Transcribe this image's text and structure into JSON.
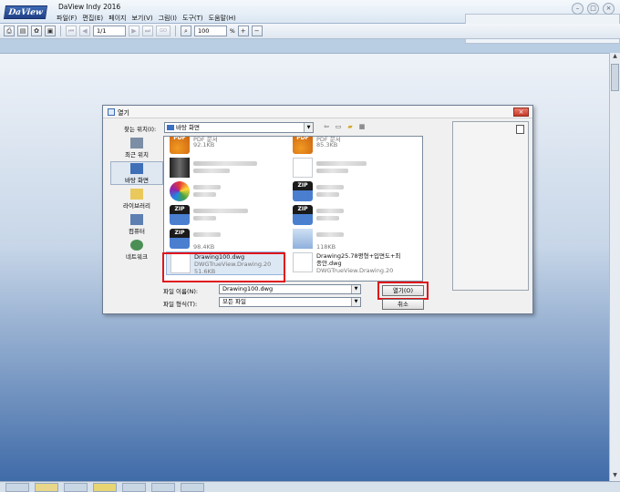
{
  "app": {
    "logo": "DaView",
    "title": "DaView Indy 2016",
    "menu": [
      "파일(F)",
      "편집(E)",
      "페이지",
      "보기(V)",
      "그림(I)",
      "도구(T)",
      "도움말(H)"
    ]
  },
  "toolbar": {
    "page_value": "1/1",
    "go_label": "GO",
    "zoom_value": "100",
    "zoom_unit": "%"
  },
  "dialog": {
    "title": "열기",
    "look_in_label": "찾는 위치(I):",
    "look_in_value": "바탕 화면",
    "places": [
      "최근 위치",
      "바탕 화면",
      "라이브러리",
      "컴퓨터",
      "네트워크"
    ],
    "files": [
      {
        "name": "PDF 문서",
        "size": "92.1KB",
        "icon": "pdf-icon"
      },
      {
        "name": "PDF 문서",
        "size": "85.3KB",
        "icon": "pdf-icon"
      },
      {
        "name": "",
        "size": "98.4KB",
        "icon": "zip-icon"
      },
      {
        "name": "",
        "size": "118KB",
        "icon": "image-icon"
      },
      {
        "name": "Drawing100.dwg",
        "type": "DWGTrueView.Drawing.20",
        "size": "51.6KB",
        "icon": "dwg-icon"
      },
      {
        "name": "Drawing25.78평형+입면도+최종안.dwg",
        "type": "DWGTrueView.Drawing.20",
        "icon": "dwg-icon"
      }
    ],
    "zip_label": "ZIP",
    "pdf_label": "PDF",
    "filename_label": "파일 이름(N):",
    "filename_value": "Drawing100.dwg",
    "filetype_label": "파일 형식(T):",
    "filetype_value": "모든 파일",
    "open_button": "열기(O)",
    "cancel_button": "취소"
  }
}
